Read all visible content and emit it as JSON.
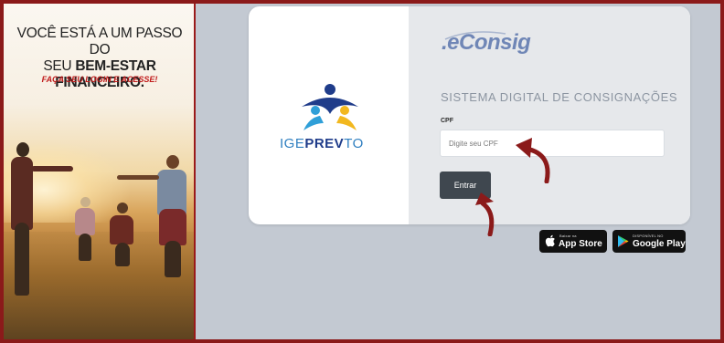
{
  "banner": {
    "headline_line1": "VOCÊ ESTÁ A UM PASSO DO",
    "headline_line2_regular": "SEU ",
    "headline_line2_bold": "BEM-ESTAR FINANCEIRO.",
    "cta": "FAÇA SEU LOGIN E ACESSE!"
  },
  "brand": {
    "logo_part1": "IGE",
    "logo_part2": "PREV",
    "logo_part3": "TO"
  },
  "login": {
    "product_logo": ".eConsig",
    "system_title": "SISTEMA DIGITAL DE CONSIGNAÇÕES",
    "cpf_label": "CPF",
    "cpf_placeholder": "Digite seu CPF",
    "cpf_value": "",
    "submit_label": "Entrar"
  },
  "stores": {
    "apple_small": "Baixar na",
    "apple_big": "App Store",
    "google_small": "DISPONÍVEL NO",
    "google_big": "Google Play"
  },
  "colors": {
    "frame_border": "#8b1a1a",
    "page_bg": "#c3c9d2",
    "button_bg": "#3f474f",
    "arrow": "#8b1a1a",
    "econsig_blue": "#6f86b6"
  },
  "icons": [
    "igeprevto-logo-icon",
    "apple-icon",
    "google-play-icon",
    "arrow-annotation-icon"
  ]
}
